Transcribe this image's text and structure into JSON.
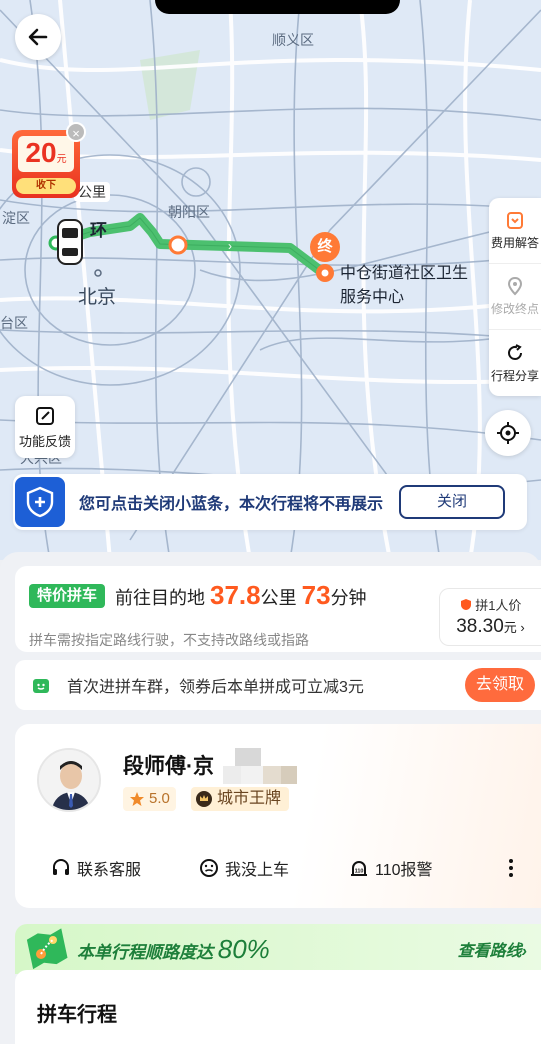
{
  "map": {
    "labels": {
      "shunyi": "顺义区",
      "chaoyang": "朝阳区",
      "beijing": "北京",
      "huan": "环",
      "gongli": "公里",
      "dian_qu": "淀区",
      "tai_qu": "台区",
      "daxing": "大兴区"
    },
    "destination_marker": "终",
    "destination_line1": "中仓街道社区卫生",
    "destination_line2": "服务中心",
    "coupon": {
      "amount": "20",
      "unit": "元",
      "take": "收下"
    },
    "side_panel": {
      "fee": "费用解答",
      "modify": "修改终点",
      "share": "行程分享"
    },
    "feedback": "功能反馈",
    "tip": {
      "text": "您可点击关闭小蓝条，本次行程将不再展示",
      "close": "关闭"
    }
  },
  "trip": {
    "tag": "特价拼车",
    "prefix": "前往目的地",
    "distance": "37.8",
    "distance_unit": "公里",
    "time": "73",
    "time_unit": "分钟",
    "notice": "拼车需按指定路线行驶，不支持改路线或指路",
    "price_label": "拼1人价",
    "price": "38.30",
    "price_unit": "元"
  },
  "group": {
    "text": "首次进拼车群，领券后本单拼成可立减3元",
    "button": "去领取"
  },
  "driver": {
    "name": "段师傅·京",
    "rating": "5.0",
    "badge": "城市王牌",
    "actions": {
      "service": "联系客服",
      "not_in_car": "我没上车",
      "police": "110报警"
    }
  },
  "route": {
    "text": "本单行程顺路度达",
    "percent": "80%",
    "link": "查看路线"
  },
  "pool": {
    "title": "拼车行程"
  },
  "colors": {
    "green": "#2fb85a",
    "orange": "#ff5a1f",
    "blue": "#1d5fd6",
    "route_green": "#4cc06f"
  }
}
